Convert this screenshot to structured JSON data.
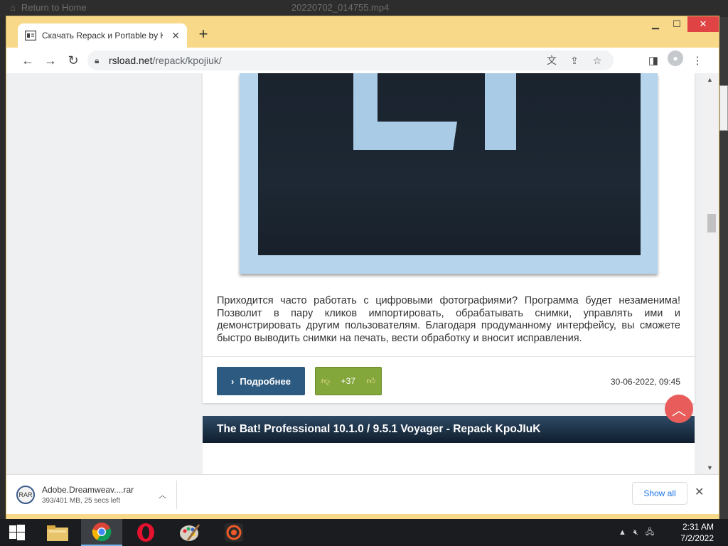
{
  "backdrop": {
    "home_label": "Return to Home",
    "file_name": "20220702_014755.mp4"
  },
  "browser": {
    "tab_title": "Скачать Repack и Portable by KpoJIuK",
    "url_domain": "rsload.net",
    "url_path": "/repack/kpojiuk/"
  },
  "article": {
    "body": "Приходится часто работать с цифровыми фотографиями? Программа будет незаменима! Позволит в пару кликов импортировать, обрабатывать снимки, управлять ими и демонстрировать другим пользователям. Благодаря продуманному интерфейсу, вы сможете быстро выводить снимки на печать, вести обработку и вносит исправления.",
    "more_button": "Подробнее",
    "rating": "+37",
    "date": "30-06-2022, 09:45"
  },
  "next_article": {
    "title": "The Bat! Professional 10.1.0 / 9.5.1 Voyager - Repack KpoJIuK"
  },
  "download": {
    "file_name": "Adobe.Dreamweav....rar",
    "status": "393/401 MB, 25 secs left",
    "show_all": "Show all"
  },
  "taskbar": {
    "time": "2:31 AM",
    "date": "7/2/2022"
  },
  "colors": {
    "window_frame": "#f7d989",
    "more_button": "#2d5a80",
    "rating": "#84a73c",
    "scroll_top": "#e85c5c",
    "close": "#e04343"
  }
}
